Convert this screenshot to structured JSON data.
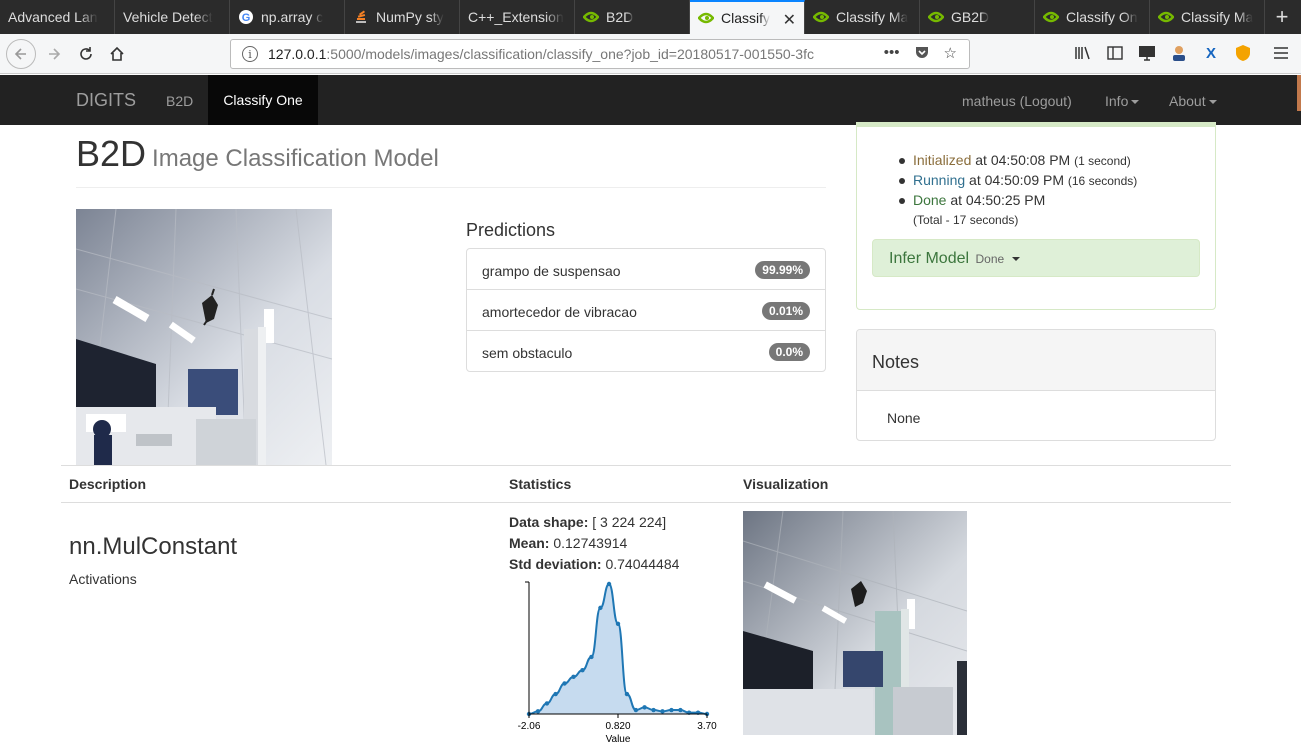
{
  "browser": {
    "tabs": [
      {
        "title": "Advanced Lan",
        "icon": "none"
      },
      {
        "title": "Vehicle Detect",
        "icon": "none"
      },
      {
        "title": "np.array c",
        "icon": "google-icon"
      },
      {
        "title": "NumPy sty",
        "icon": "stackoverflow-icon"
      },
      {
        "title": "C++_Extension",
        "icon": "none"
      },
      {
        "title": "B2D",
        "icon": "nvidia-icon"
      },
      {
        "title": "Classify",
        "icon": "nvidia-icon"
      },
      {
        "title": "Classify Ma",
        "icon": "nvidia-icon"
      },
      {
        "title": "GB2D",
        "icon": "nvidia-icon"
      },
      {
        "title": "Classify On",
        "icon": "nvidia-icon"
      },
      {
        "title": "Classify Ma",
        "icon": "nvidia-icon"
      }
    ],
    "url_host": "127.0.0.1",
    "url_path": ":5000/models/images/classification/classify_one?job_id=20180517-001550-3fc"
  },
  "app": {
    "brand": "DIGITS",
    "nav_model": "B2D",
    "nav_active": "Classify One",
    "user": "matheus (Logout)",
    "info": "Info",
    "about": "About"
  },
  "page": {
    "title": "B2D",
    "subtitle": "Image Classification Model"
  },
  "predictions": {
    "heading": "Predictions",
    "items": [
      {
        "label": "grampo de suspensao",
        "value": "99.99%"
      },
      {
        "label": "amortecedor de vibracao",
        "value": "0.01%"
      },
      {
        "label": "sem obstaculo",
        "value": "0.0%"
      }
    ]
  },
  "status": {
    "items": [
      {
        "state": "Initialized",
        "time": "at 04:50:08 PM",
        "note": "(1 second)"
      },
      {
        "state": "Running",
        "time": "at 04:50:09 PM",
        "note": "(16 seconds)"
      },
      {
        "state": "Done",
        "time": "at 04:50:25 PM",
        "note": ""
      }
    ],
    "total": "(Total - 17 seconds)",
    "infer_label": "Infer Model",
    "infer_state": "Done"
  },
  "notes": {
    "heading": "Notes",
    "body": "None"
  },
  "layers": {
    "headers": {
      "description": "Description",
      "statistics": "Statistics",
      "visualization": "Visualization"
    },
    "name": "nn.MulConstant",
    "sub": "Activations",
    "shape_label": "Data shape:",
    "shape_value": "[ 3 224 224]",
    "mean_label": "Mean:",
    "mean_value": "0.12743914",
    "std_label": "Std deviation:",
    "std_value": "0.74044484"
  },
  "chart_data": {
    "type": "area",
    "xlabel": "Value",
    "ylabel": "",
    "title": "",
    "xlim": [
      -2.06,
      3.7
    ],
    "xticks": [
      "-2.06",
      "0.820",
      "3.70"
    ],
    "x": [
      -2.06,
      -1.77,
      -1.48,
      -1.2,
      -0.91,
      -0.62,
      -0.33,
      -0.04,
      0.25,
      0.53,
      0.82,
      1.11,
      1.4,
      1.68,
      1.97,
      2.26,
      2.55,
      2.84,
      3.12,
      3.41,
      3.7
    ],
    "y": [
      0.0,
      0.02,
      0.08,
      0.15,
      0.23,
      0.28,
      0.33,
      0.43,
      0.8,
      0.98,
      0.68,
      0.15,
      0.03,
      0.05,
      0.03,
      0.02,
      0.03,
      0.03,
      0.01,
      0.01,
      0.0
    ],
    "color": "#1f77b4",
    "fill": "#c6dbef"
  }
}
